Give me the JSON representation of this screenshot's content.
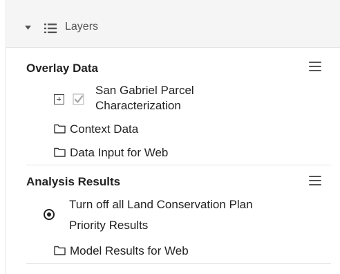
{
  "header": {
    "title": "Layers",
    "collapse_icon": "caret-down-icon",
    "list_icon": "list-icon"
  },
  "groups": [
    {
      "title": "Overlay Data",
      "menu_icon": "hamburger-icon",
      "items": [
        {
          "label_line1": "San Gabriel Parcel",
          "label_line2": "Characterization",
          "icon": "expand-plus-icon",
          "checked": true
        },
        {
          "label": "Context Data",
          "icon": "folder-icon"
        },
        {
          "label": "Data Input for Web",
          "icon": "folder-icon"
        }
      ]
    },
    {
      "title": "Analysis Results",
      "menu_icon": "hamburger-icon",
      "items": [
        {
          "label_line1": "Turn off all Land Conservation Plan",
          "label_line2": "Priority Results",
          "icon": "radio-selected-icon"
        },
        {
          "label": "Model Results for Web",
          "icon": "folder-icon"
        }
      ]
    }
  ]
}
